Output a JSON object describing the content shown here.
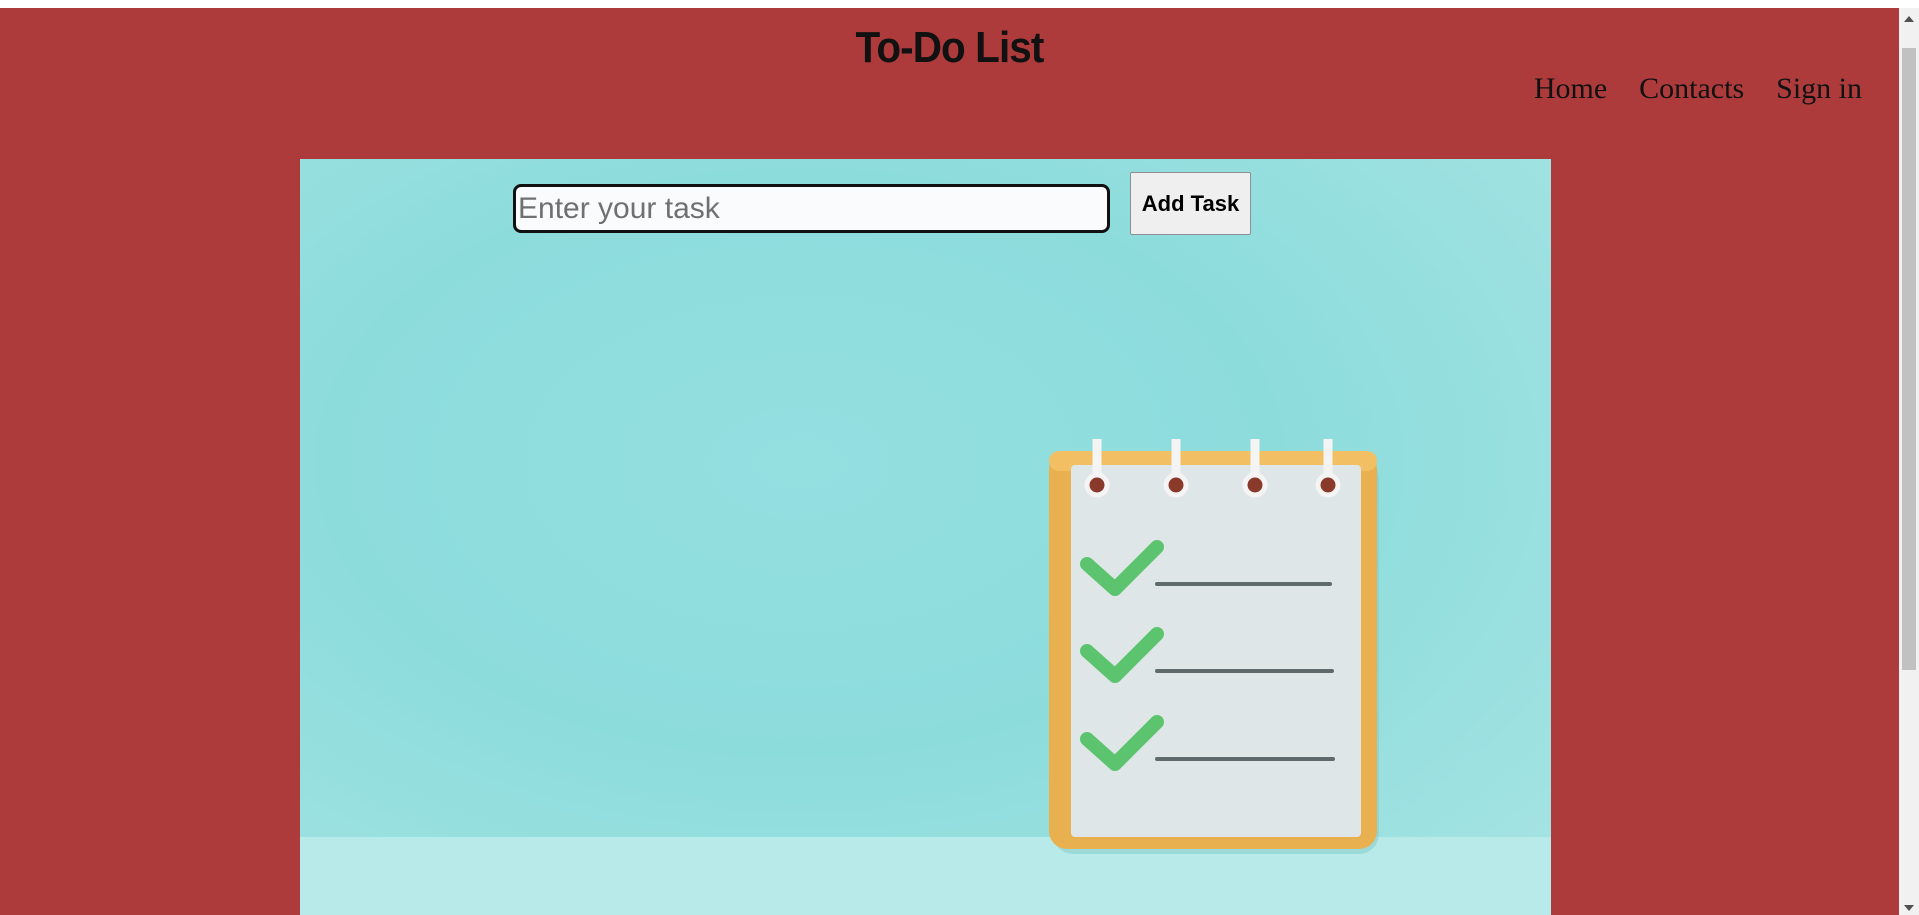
{
  "header": {
    "title": "To-Do List",
    "nav": [
      {
        "label": "Home"
      },
      {
        "label": "Contacts"
      },
      {
        "label": "Sign in"
      }
    ]
  },
  "task_form": {
    "input_placeholder": "Enter your task",
    "input_value": "",
    "add_button_label": "Add Task"
  },
  "colors": {
    "page_background": "#ad3b3c",
    "hero_background": "#8ddcdc",
    "checkmark": "#5cc46e",
    "notepad_frame": "#e9b04f"
  },
  "icons": {
    "hero_illustration": "checklist-notepad-icon"
  }
}
